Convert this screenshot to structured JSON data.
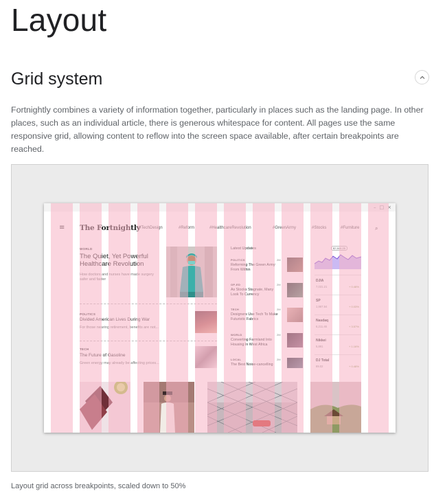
{
  "page": {
    "title": "Layout",
    "section_title": "Grid system",
    "intro": "Fortnightly combines a variety of information together, particularly in places such as the landing page. In other places, such as an individual article, there is generous whitespace for content. All pages use the same responsive grid, allowing content to reflow into the screen space available, after certain breakpoints are reached.",
    "caption": "Layout grid across breakpoints, scaled down to 50%"
  },
  "window": {
    "controls": [
      "–",
      "□",
      "×"
    ]
  },
  "mock": {
    "logo": "The Fortnightly",
    "nav": [
      "#TechDesign",
      "#Reform",
      "#HealthcareRevolution",
      "#GreenArmy",
      "#Stocks",
      "#Furniture"
    ],
    "lead": {
      "kicker": "WORLD",
      "headline": "The Quiet, Yet Powerful Healthcare Revolution",
      "deck": "How doctors and nurses have made surgery safer and faster"
    },
    "story2": {
      "kicker": "POLITICS",
      "headline": "Divided American Lives During War",
      "deck": "For those nearing retirement, benefits are not..."
    },
    "story3": {
      "kicker": "TECH",
      "headline": "The Future of Gasoline",
      "deck": "Green energy may already be affecting prices..."
    },
    "latest": {
      "title": "Latest Updates",
      "items": [
        {
          "kicker": "POLITICS",
          "time": "2M",
          "headline": "Reforming The Green Army From Within"
        },
        {
          "kicker": "OP-ED",
          "time": "2M",
          "headline": "As Stocks Stagnate, Many Look To Currency"
        },
        {
          "kicker": "TECH",
          "time": "2M",
          "headline": "Designers Use Tech To Make Futuristic Fabrics"
        },
        {
          "kicker": "WORLD",
          "time": "2M",
          "headline": "Converting Farmland Into Housing In West Africa"
        },
        {
          "kicker": "LOCAL",
          "time": "2M",
          "headline": "The Best Noise-cancelling"
        }
      ]
    },
    "stocks": {
      "tag": "$7,510.25",
      "items": [
        {
          "name": "DJIA",
          "value": "7,031.21",
          "change": "+ 0.48%"
        },
        {
          "name": "SP",
          "value": "1,967.84",
          "change": "+ 0.03%"
        },
        {
          "name": "Nasdaq",
          "value": "6,211.46",
          "change": "+ 3.57%"
        },
        {
          "name": "Nikkei",
          "value": "5,891",
          "change": "+ 1.16%"
        },
        {
          "name": "DJ Total",
          "value": "89.02",
          "change": "+ 0.48%"
        }
      ]
    }
  },
  "colors": {
    "grid_column": "#f8b2c4",
    "figure_bg": "#ebebeb",
    "accent_chart": "#7b4fd6"
  }
}
